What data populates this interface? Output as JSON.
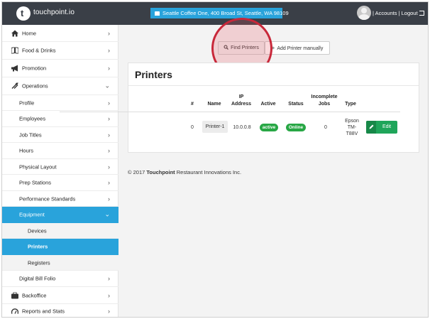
{
  "header": {
    "brand": "touchpoint.io",
    "logo_letter": "t",
    "location": "Seattle Coffee One, 400 Broad St, Seattle, WA 98109",
    "accounts_label": "Accounts",
    "logout_label": "Logout",
    "separator": "|"
  },
  "sidebar": {
    "items": [
      {
        "label": "Home",
        "icon": "home-icon"
      },
      {
        "label": "Food & Drinks",
        "icon": "book-icon"
      },
      {
        "label": "Promotion",
        "icon": "megaphone-icon"
      },
      {
        "label": "Operations",
        "icon": "tools-icon"
      },
      {
        "label": "Profile"
      },
      {
        "label": "Employees"
      },
      {
        "label": "Job Titles"
      },
      {
        "label": "Hours"
      },
      {
        "label": "Physical Layout"
      },
      {
        "label": "Prep Stations"
      },
      {
        "label": "Performance Standards"
      },
      {
        "label": "Equipment"
      },
      {
        "label": "Devices"
      },
      {
        "label": "Printers"
      },
      {
        "label": "Registers"
      },
      {
        "label": "Digital Bill Folio"
      },
      {
        "label": "Backoffice",
        "icon": "briefcase-icon"
      },
      {
        "label": "Reports and Stats",
        "icon": "speedometer-icon"
      }
    ],
    "chevron_right": "›",
    "chevron_down": "⌄"
  },
  "toolbar": {
    "find_label": "Find Printers",
    "add_label": "Add Printer manually",
    "add_prefix": "+"
  },
  "printers": {
    "title": "Printers",
    "columns": [
      "#",
      "Name",
      "IP Address",
      "Active",
      "Status",
      "Incomplete Jobs",
      "Type"
    ],
    "rows": [
      {
        "num": "0",
        "name": "Printer-1",
        "ip": "10.0.0.8",
        "active": "active",
        "status": "Online",
        "jobs": "0",
        "type": "Epson TM-T88V",
        "edit_label": "Edit"
      }
    ]
  },
  "footer": {
    "prefix": "© 2017 ",
    "company": "Touchpoint",
    "suffix": " Restaurant Innovations Inc."
  },
  "colors": {
    "topbar": "#3a3f47",
    "accent": "#29a3db",
    "success": "#28a745",
    "highlight_ring": "#c8283a"
  }
}
